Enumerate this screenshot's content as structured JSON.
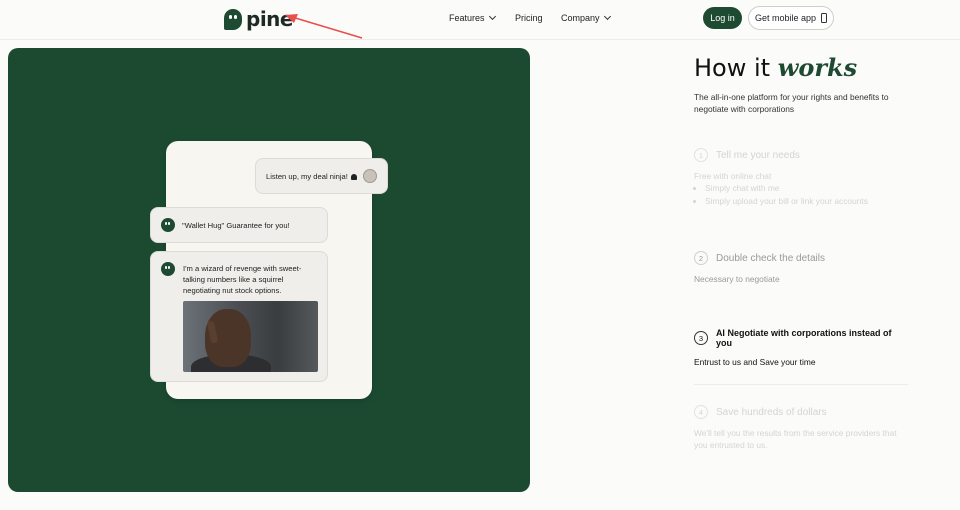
{
  "header": {
    "logo_text": "pine",
    "nav": [
      {
        "label": "Features",
        "has_dropdown": true
      },
      {
        "label": "Pricing",
        "has_dropdown": false
      },
      {
        "label": "Company",
        "has_dropdown": true
      }
    ],
    "login_label": "Log in",
    "app_label": "Get mobile app",
    "annotation_color": "#e94e4e"
  },
  "chat": {
    "user_message": "Listen up, my deal ninja!",
    "bot_message_1": "\"Wallet Hug\" Guarantee for you!",
    "bot_message_2": "I'm a wizard of revenge with sweet-talking numbers like a squirrel negotiating nut stock options."
  },
  "how_it_works": {
    "title_plain": "How it",
    "title_accent": "works",
    "subtitle": "The all-in-one platform for your rights and benefits to negotiate with corporations",
    "steps": [
      {
        "num": "1",
        "title": "Tell me your needs",
        "desc": "Free with online chat",
        "bullets": [
          "Simply chat with me",
          "Simply upload your bill or link your accounts"
        ]
      },
      {
        "num": "2",
        "title": "Double check the details",
        "desc": "Necessary to negotiate"
      },
      {
        "num": "3",
        "title": "AI Negotiate with corporations instead of you",
        "desc": "Entrust to us and Save your time"
      },
      {
        "num": "4",
        "title": "Save hundreds of dollars",
        "desc": "We'll tell you the results from the service providers that you entrusted to us."
      }
    ]
  },
  "colors": {
    "brand_green": "#1d4a31",
    "background": "#fbfbf9"
  }
}
